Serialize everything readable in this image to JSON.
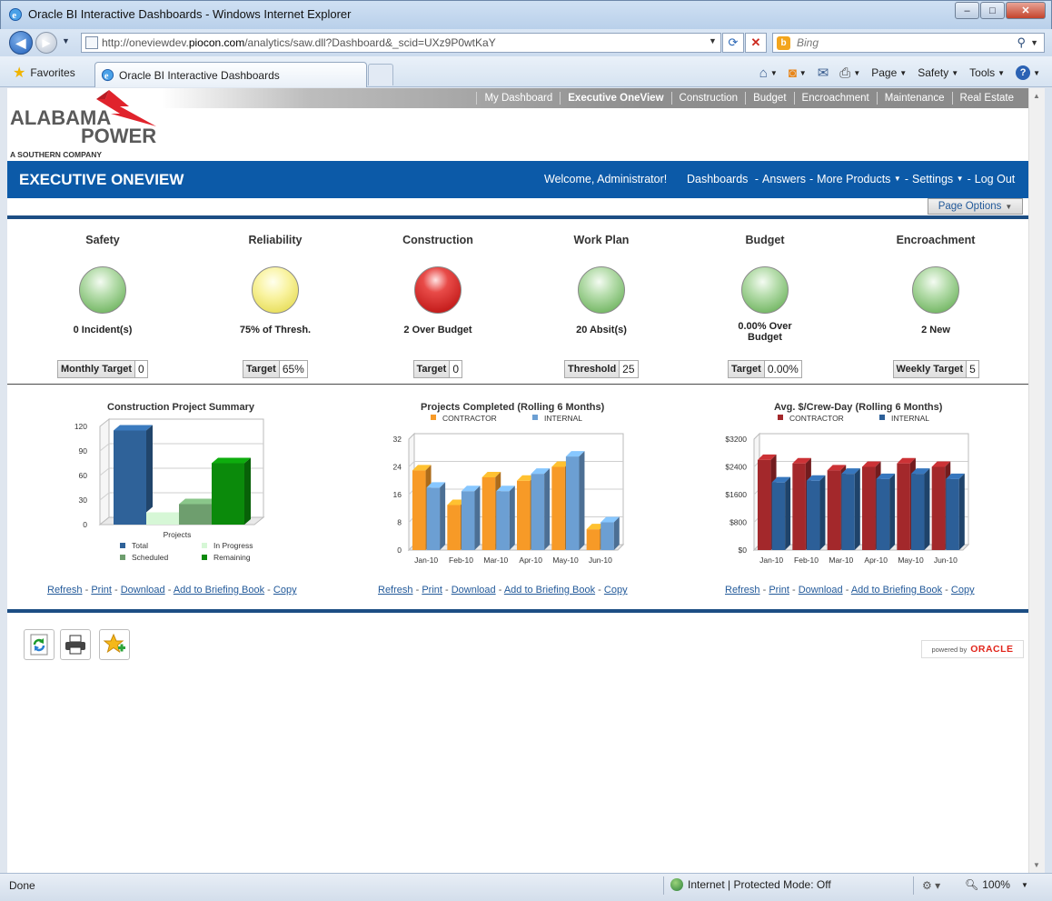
{
  "window": {
    "title": "Oracle BI Interactive Dashboards - Windows Internet Explorer",
    "min": "–",
    "max": "□",
    "close": "✕"
  },
  "address_bar": {
    "url_prefix": "http://oneviewdev.",
    "url_host": "piocon.com",
    "url_suffix": "/analytics/saw.dll?Dashboard&_scid=UXz9P0wtKaY",
    "search_placeholder": "Bing"
  },
  "favorites_bar": {
    "favorites_label": "Favorites",
    "tab_label": "Oracle BI Interactive Dashboards",
    "commands": [
      "Page",
      "Safety",
      "Tools"
    ]
  },
  "top_nav": {
    "items": [
      "My Dashboard",
      "Executive OneView",
      "Construction",
      "Budget",
      "Encroachment",
      "Maintenance",
      "Real Estate"
    ],
    "active": "Executive OneView"
  },
  "logo": {
    "line1": "ALABAMA",
    "line2": "POWER",
    "line3": "A SOUTHERN COMPANY"
  },
  "header": {
    "page_title": "EXECUTIVE ONEVIEW",
    "welcome": "Welcome, Administrator!",
    "links": {
      "dashboards": "Dashboards",
      "answers": "Answers",
      "more_products": "More Products",
      "settings": "Settings",
      "logout": "Log Out"
    },
    "page_options": "Page Options"
  },
  "kpis": [
    {
      "title": "Safety",
      "status": "green",
      "value": "0 Incident(s)",
      "target_label": "Monthly Target",
      "target_value": "0"
    },
    {
      "title": "Reliability",
      "status": "yellow",
      "value": "75% of Thresh.",
      "target_label": "Target",
      "target_value": "65%"
    },
    {
      "title": "Construction",
      "status": "red",
      "value": "2 Over Budget",
      "target_label": "Target",
      "target_value": "0"
    },
    {
      "title": "Work Plan",
      "status": "green",
      "value": "20 Absit(s)",
      "target_label": "Threshold",
      "target_value": "25"
    },
    {
      "title": "Budget",
      "status": "green",
      "value": "0.00% Over Budget",
      "target_label": "Target",
      "target_value": "0.00%"
    },
    {
      "title": "Encroachment",
      "status": "green",
      "value": "2 New",
      "target_label": "Weekly Target",
      "target_value": "5"
    }
  ],
  "chart_links": {
    "refresh": "Refresh",
    "print": "Print",
    "download": "Download",
    "briefing": "Add to Briefing Book",
    "copy": "Copy"
  },
  "chart_data": [
    {
      "type": "bar",
      "title": "Construction Project Summary",
      "categories": [
        "Projects"
      ],
      "ylim": [
        0,
        120
      ],
      "yticks": [
        0,
        30,
        60,
        90,
        120
      ],
      "series": [
        {
          "name": "Total",
          "values": [
            115
          ],
          "color": "#2f6299"
        },
        {
          "name": "In Progress",
          "values": [
            15
          ],
          "color": "#d6f7d6"
        },
        {
          "name": "Scheduled",
          "values": [
            25
          ],
          "color": "#6e9e6e"
        },
        {
          "name": "Remaining",
          "values": [
            75
          ],
          "color": "#0b8a0b"
        }
      ],
      "legend": "bottom",
      "grid": true
    },
    {
      "type": "bar",
      "title": "Projects Completed (Rolling 6 Months)",
      "categories": [
        "Jan-10",
        "Feb-10",
        "Mar-10",
        "Apr-10",
        "May-10",
        "Jun-10"
      ],
      "ylim": [
        0,
        32
      ],
      "yticks": [
        0,
        8,
        16,
        24,
        32
      ],
      "series": [
        {
          "name": "CONTRACTOR",
          "values": [
            23,
            13,
            21,
            20,
            24,
            6
          ],
          "color": "#f79a27"
        },
        {
          "name": "INTERNAL",
          "values": [
            18,
            17,
            17,
            22,
            27,
            8
          ],
          "color": "#6c9fd3"
        }
      ],
      "legend": "top",
      "grid": true
    },
    {
      "type": "bar",
      "title": "Avg. $/Crew-Day (Rolling 6 Months)",
      "categories": [
        "Jan-10",
        "Feb-10",
        "Mar-10",
        "Apr-10",
        "May-10",
        "Jun-10"
      ],
      "ylim": [
        0,
        3200
      ],
      "yticks": [
        "$0",
        "$800",
        "$1600",
        "$2400",
        "$3200"
      ],
      "series": [
        {
          "name": "CONTRACTOR",
          "values": [
            2600,
            2500,
            2300,
            2400,
            2500,
            2400
          ],
          "color": "#a3282b"
        },
        {
          "name": "INTERNAL",
          "values": [
            1950,
            2000,
            2200,
            2050,
            2200,
            2050
          ],
          "color": "#2c5f98"
        }
      ],
      "legend": "top",
      "grid": true
    }
  ],
  "status_bar": {
    "text": "Done",
    "zone": "Internet | Protected Mode: Off",
    "zoom": "100%"
  },
  "footer": {
    "powered_by": "powered by",
    "brand": "ORACLE"
  }
}
